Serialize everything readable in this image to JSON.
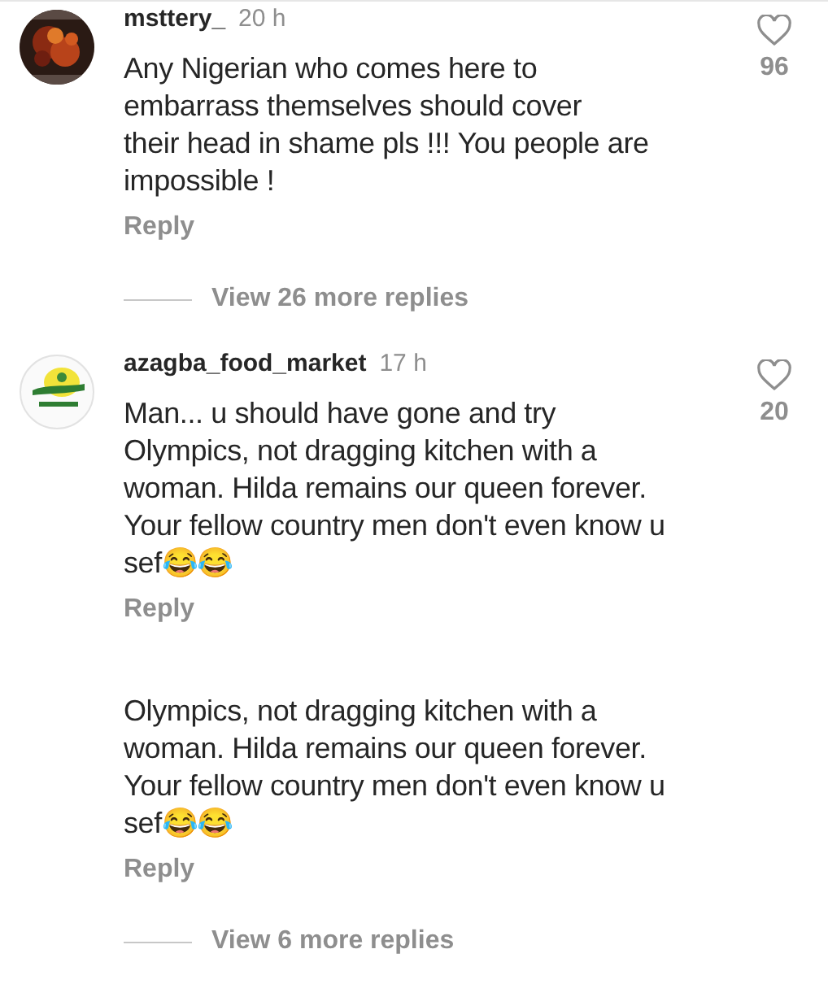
{
  "comments": [
    {
      "kind": "full",
      "username": "msttery_",
      "time": "20 h",
      "lines": [
        "Any Nigerian who comes here to",
        "embarrass themselves should cover",
        "their head in shame pls !!! You people are",
        "impossible !"
      ],
      "likes": "96",
      "reply": "Reply",
      "more_replies": "View 26 more replies"
    },
    {
      "kind": "full",
      "username": "azagba_food_market",
      "time": "17 h",
      "lines": [
        "Man... u should have gone and try",
        "Olympics, not dragging kitchen with a",
        "woman. Hilda remains our queen forever.",
        "Your fellow country men don't even know u",
        "sef😂😂"
      ],
      "likes": "20",
      "reply": "Reply"
    },
    {
      "kind": "fragment",
      "lines": [
        "Olympics, not dragging kitchen with a",
        "woman. Hilda remains our queen forever.",
        "Your fellow country men don't even know u",
        "sef😂😂"
      ],
      "reply": "Reply",
      "more_replies": "View 6 more replies"
    }
  ]
}
